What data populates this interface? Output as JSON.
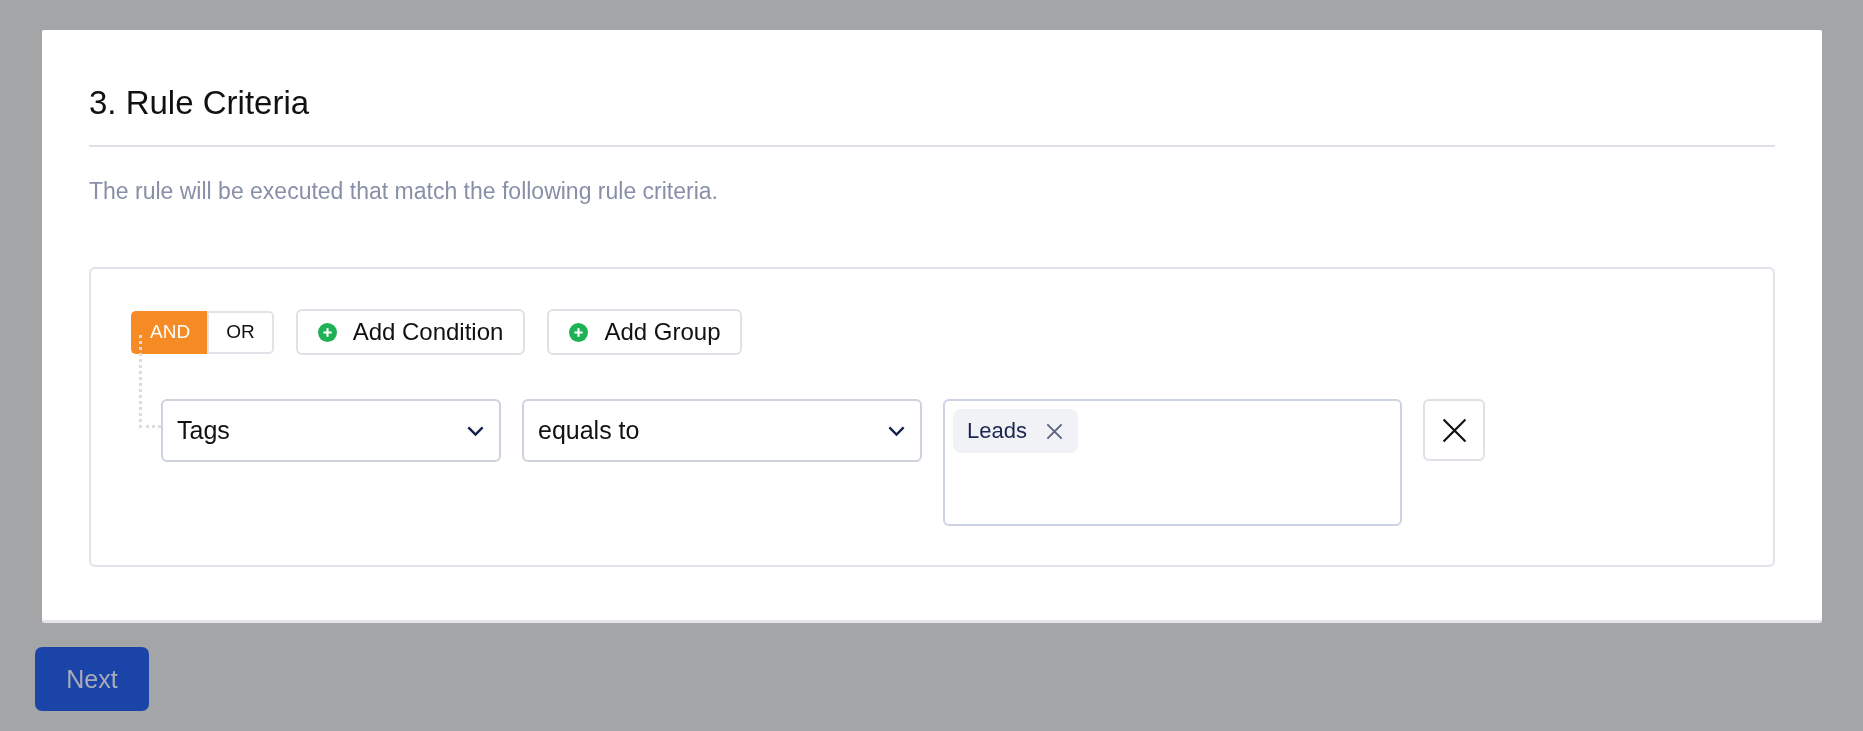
{
  "section": {
    "title": "3. Rule Criteria",
    "description": "The rule will be executed that match the following rule criteria."
  },
  "builder": {
    "logic": [
      {
        "label": "AND",
        "selected": true
      },
      {
        "label": "OR",
        "selected": false
      }
    ],
    "actions": [
      {
        "label": "Add Condition"
      },
      {
        "label": "Add Group"
      }
    ],
    "conditions": [
      {
        "field": "Tags",
        "operator": "equals to",
        "values": [
          "Leads"
        ]
      }
    ]
  },
  "next_button": {
    "label": "Next"
  }
}
